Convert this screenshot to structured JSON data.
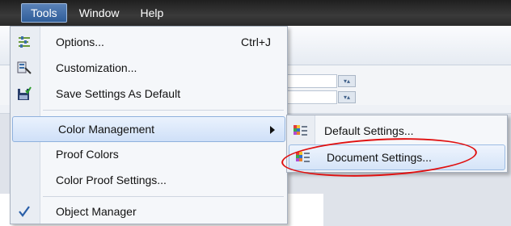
{
  "menubar": {
    "items": [
      {
        "label": "Tools",
        "active": true
      },
      {
        "label": "Window",
        "active": false
      },
      {
        "label": "Help",
        "active": false
      }
    ]
  },
  "tools_menu": {
    "items": [
      {
        "label": "Options...",
        "shortcut": "Ctrl+J",
        "icon": "options-icon"
      },
      {
        "label": "Customization...",
        "shortcut": "",
        "icon": "customization-icon"
      },
      {
        "label": "Save Settings As Default",
        "shortcut": "",
        "icon": "save-icon"
      },
      {
        "label": "Color Management",
        "shortcut": "",
        "icon": "",
        "submenu": true,
        "highlighted": true
      },
      {
        "label": "Proof Colors",
        "shortcut": "",
        "icon": ""
      },
      {
        "label": "Color Proof Settings...",
        "shortcut": "",
        "icon": ""
      },
      {
        "label": "Object Manager",
        "shortcut": "",
        "icon": "checkmark-icon",
        "checked": true
      }
    ]
  },
  "color_submenu": {
    "items": [
      {
        "label": "Default Settings...",
        "icon": "color-settings-icon"
      },
      {
        "label": "Document Settings...",
        "icon": "color-settings-icon",
        "highlighted": true
      }
    ]
  },
  "colors": {
    "menubar_bg": "#2a2a2a",
    "highlight": "#cfe0f8",
    "annotation": "#e01010"
  }
}
